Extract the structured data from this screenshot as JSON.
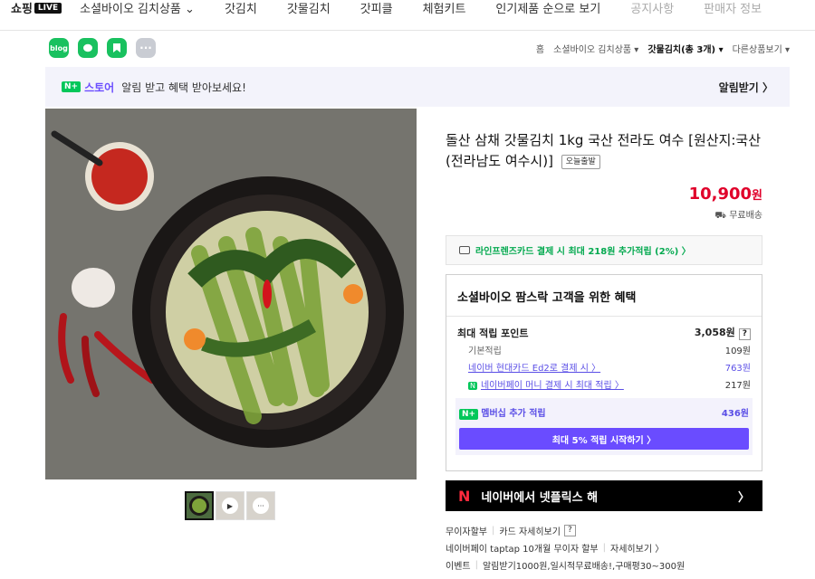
{
  "topnav": {
    "logo": "쇼핑",
    "logo_badge": "LIVE",
    "items": [
      {
        "label": "소셜바이오 김치상품 ⌄"
      },
      {
        "label": "갓김치"
      },
      {
        "label": "갓물김치"
      },
      {
        "label": "갓피클"
      },
      {
        "label": "체험키트"
      },
      {
        "label": "인기제품 순으로 보기"
      },
      {
        "label": "공지사항"
      },
      {
        "label": "판매자 정보"
      }
    ]
  },
  "share": {
    "blog_label": "blog",
    "more_label": "···"
  },
  "breadcrumb": {
    "home": "홈",
    "category": "소셜바이오 김치상품 ▾",
    "current": "갓물김치(총 3개) ▾",
    "other": "다른상품보기 ▾"
  },
  "banner": {
    "nplus": "N+",
    "store": "스토어",
    "text": "알림 받고 혜택 받아보세요!",
    "button": "알림받기 〉"
  },
  "product": {
    "title": "돌산 삼채 갓물김치 1kg 국산 전라도 여수 [원산지:국산(전라남도 여수시)]",
    "badge": "오늘출발",
    "price": "10,900",
    "price_unit": "원",
    "shipping": "무료배송"
  },
  "card_promo": "라인프렌즈카드 결제 시 최대 218원 추가적립 (2%) 〉",
  "benefit": {
    "title": "소셜바이오 팜스락 고객을 위한 혜택",
    "max_points_label": "최대 적립 포인트",
    "max_points_value": "3,058원",
    "q": "?",
    "rows": [
      {
        "label": "기본적립",
        "value": "109원"
      },
      {
        "label": "네이버 현대카드 Ed2로 결제 시 〉",
        "value": "763원"
      },
      {
        "label": "네이버페이 머니 결제 시 최대 적립 〉",
        "value": "217원"
      }
    ],
    "npay_badge": "N",
    "member_nplus": "N+",
    "member_label": "멤버십 추가 적립",
    "member_value": "436원",
    "start_button": "최대 5% 적립 시작하기 〉"
  },
  "netflix": {
    "logo": "N",
    "text": "네이버에서 넷플릭스 해",
    "arrow": "〉"
  },
  "info": {
    "line1_a": "무이자할부",
    "line1_b": "카드 자세히보기",
    "line1_q": "?",
    "line2_a": "네이버페이 taptap 10개월 무이자 할부",
    "line2_b": "자세히보기 〉",
    "line3_a": "이벤트",
    "line3_b": "알림받기1000원,일시적무료배송!,구매평30~300원"
  },
  "colors": {
    "price": "#e0002a",
    "naver_green": "#03c75a",
    "purple": "#6a4cff"
  }
}
